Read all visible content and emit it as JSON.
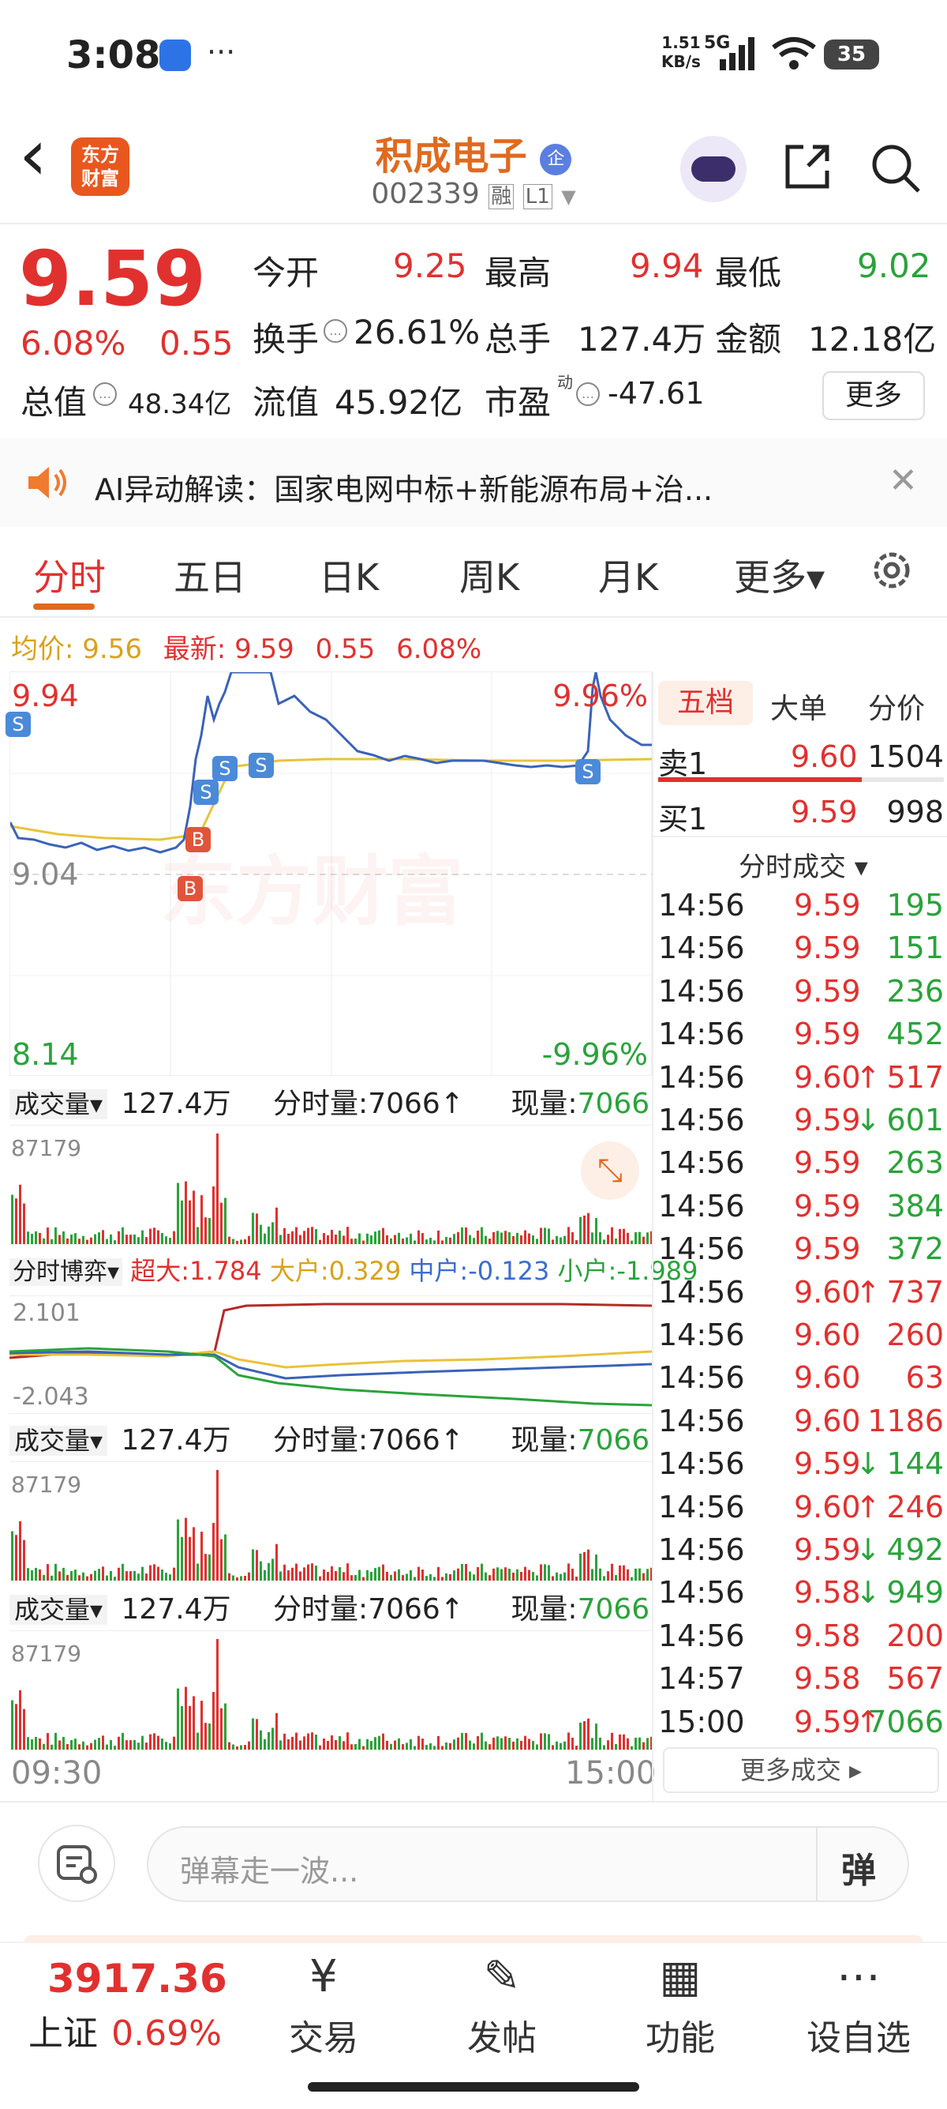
{
  "status_bar": {
    "time": "3:08",
    "more": "···",
    "net_speed_top": "1.51",
    "net_speed_bottom": "KB/s",
    "network": "5G",
    "battery": "35"
  },
  "header": {
    "back": "‹",
    "logo_line1": "东方",
    "logo_line2": "财富",
    "stock_name": "积成电子",
    "badge": "企",
    "stock_code": "002339",
    "tag_margin": "融",
    "tag_level": "L1"
  },
  "quote": {
    "price": "9.59",
    "change_pct": "6.08%",
    "change_amt": "0.55",
    "open_label": "今开",
    "open": "9.25",
    "high_label": "最高",
    "high": "9.94",
    "low_label": "最低",
    "low": "9.02",
    "turnover_label": "换手",
    "turnover": "26.61%",
    "volume_label": "总手",
    "volume": "127.4万",
    "amount_label": "金额",
    "amount": "12.18亿",
    "mktcap_label": "总值",
    "mktcap": "48.34亿",
    "float_label": "流值",
    "float": "45.92亿",
    "pe_label": "市盈",
    "pe_sup": "动",
    "pe": "-47.61",
    "more_btn": "更多"
  },
  "ai_bar": {
    "text": "AI异动解读：国家电网中标+新能源布局+治...",
    "close": "✕"
  },
  "tabs": [
    "分时",
    "五日",
    "日K",
    "周K",
    "月K",
    "更多▾"
  ],
  "chart_header": {
    "avg_label": "均价:",
    "avg": "9.56",
    "latest_label": "最新:",
    "latest": "9.59",
    "chg": "0.55",
    "pct": "6.08%"
  },
  "chart_labels": {
    "top_price": "9.94",
    "top_pct": "9.96%",
    "mid_price": "9.04",
    "bottom_price": "8.14",
    "bottom_pct": "-9.96%",
    "watermark": "东方财富",
    "time_start": "09:30",
    "time_end": "15:00"
  },
  "volume_panel": {
    "label": "成交量▾",
    "total": "127.4万",
    "tick_label": "分时量:",
    "tick": "7066↑",
    "now_label": "现量:",
    "now": "7066",
    "max": "87179"
  },
  "flow_panel": {
    "label": "分时博弈▾",
    "super_label": "超大:",
    "super": "1.784",
    "large_label": "大户:",
    "large": "0.329",
    "mid_label": "中户:",
    "mid": "-0.123",
    "small_label": "小户:",
    "small": "-1.989",
    "top": "2.101",
    "bottom": "-2.043"
  },
  "right_tabs": [
    "五档",
    "大单",
    "分价"
  ],
  "order_book": {
    "sell_label": "卖1",
    "sell_price": "9.60",
    "sell_qty": "1504",
    "buy_label": "买1",
    "buy_price": "9.59",
    "buy_qty": "998"
  },
  "trades_header": "分时成交 ▾",
  "trades": [
    {
      "t": "14:56",
      "p": "9.59",
      "a": "",
      "q": "195",
      "pc": "red",
      "qc": "green"
    },
    {
      "t": "14:56",
      "p": "9.59",
      "a": "",
      "q": "151",
      "pc": "red",
      "qc": "green"
    },
    {
      "t": "14:56",
      "p": "9.59",
      "a": "",
      "q": "236",
      "pc": "red",
      "qc": "green"
    },
    {
      "t": "14:56",
      "p": "9.59",
      "a": "",
      "q": "452",
      "pc": "red",
      "qc": "green"
    },
    {
      "t": "14:56",
      "p": "9.60",
      "a": "↑",
      "q": "517",
      "pc": "red",
      "qc": "red"
    },
    {
      "t": "14:56",
      "p": "9.59",
      "a": "↓",
      "q": "601",
      "pc": "red",
      "qc": "green"
    },
    {
      "t": "14:56",
      "p": "9.59",
      "a": "",
      "q": "263",
      "pc": "red",
      "qc": "green"
    },
    {
      "t": "14:56",
      "p": "9.59",
      "a": "",
      "q": "384",
      "pc": "red",
      "qc": "green"
    },
    {
      "t": "14:56",
      "p": "9.59",
      "a": "",
      "q": "372",
      "pc": "red",
      "qc": "green"
    },
    {
      "t": "14:56",
      "p": "9.60",
      "a": "↑",
      "q": "737",
      "pc": "red",
      "qc": "red"
    },
    {
      "t": "14:56",
      "p": "9.60",
      "a": "",
      "q": "260",
      "pc": "red",
      "qc": "red"
    },
    {
      "t": "14:56",
      "p": "9.60",
      "a": "",
      "q": "63",
      "pc": "red",
      "qc": "red"
    },
    {
      "t": "14:56",
      "p": "9.60",
      "a": "",
      "q": "1186",
      "pc": "red",
      "qc": "red"
    },
    {
      "t": "14:56",
      "p": "9.59",
      "a": "↓",
      "q": "144",
      "pc": "red",
      "qc": "green"
    },
    {
      "t": "14:56",
      "p": "9.60",
      "a": "↑",
      "q": "246",
      "pc": "red",
      "qc": "red"
    },
    {
      "t": "14:56",
      "p": "9.59",
      "a": "↓",
      "q": "492",
      "pc": "red",
      "qc": "green"
    },
    {
      "t": "14:56",
      "p": "9.58",
      "a": "↓",
      "q": "949",
      "pc": "red",
      "qc": "green"
    },
    {
      "t": "14:56",
      "p": "9.58",
      "a": "",
      "q": "200",
      "pc": "red",
      "qc": "red"
    },
    {
      "t": "14:57",
      "p": "9.58",
      "a": "",
      "q": "567",
      "pc": "red",
      "qc": "red"
    },
    {
      "t": "15:00",
      "p": "9.59",
      "a": "↑",
      "q": "7066",
      "pc": "red",
      "qc": "green"
    }
  ],
  "more_trades": "更多成交 ▸",
  "comment": {
    "placeholder": "弹幕走一波...",
    "danmu": "弹"
  },
  "index": {
    "value": "3917.36",
    "name": "上证",
    "pct": "0.69%"
  },
  "bottom_nav": [
    {
      "label": "交易",
      "icon": "trade-icon"
    },
    {
      "label": "发帖",
      "icon": "edit-icon"
    },
    {
      "label": "功能",
      "icon": "grid-icon"
    },
    {
      "label": "设自选",
      "icon": "more-icon"
    }
  ],
  "colors": {
    "up": "#e0312f",
    "down": "#2aa33a",
    "accent": "#e06a1e",
    "avg": "#e8c33a",
    "price_line": "#3a63b8"
  }
}
